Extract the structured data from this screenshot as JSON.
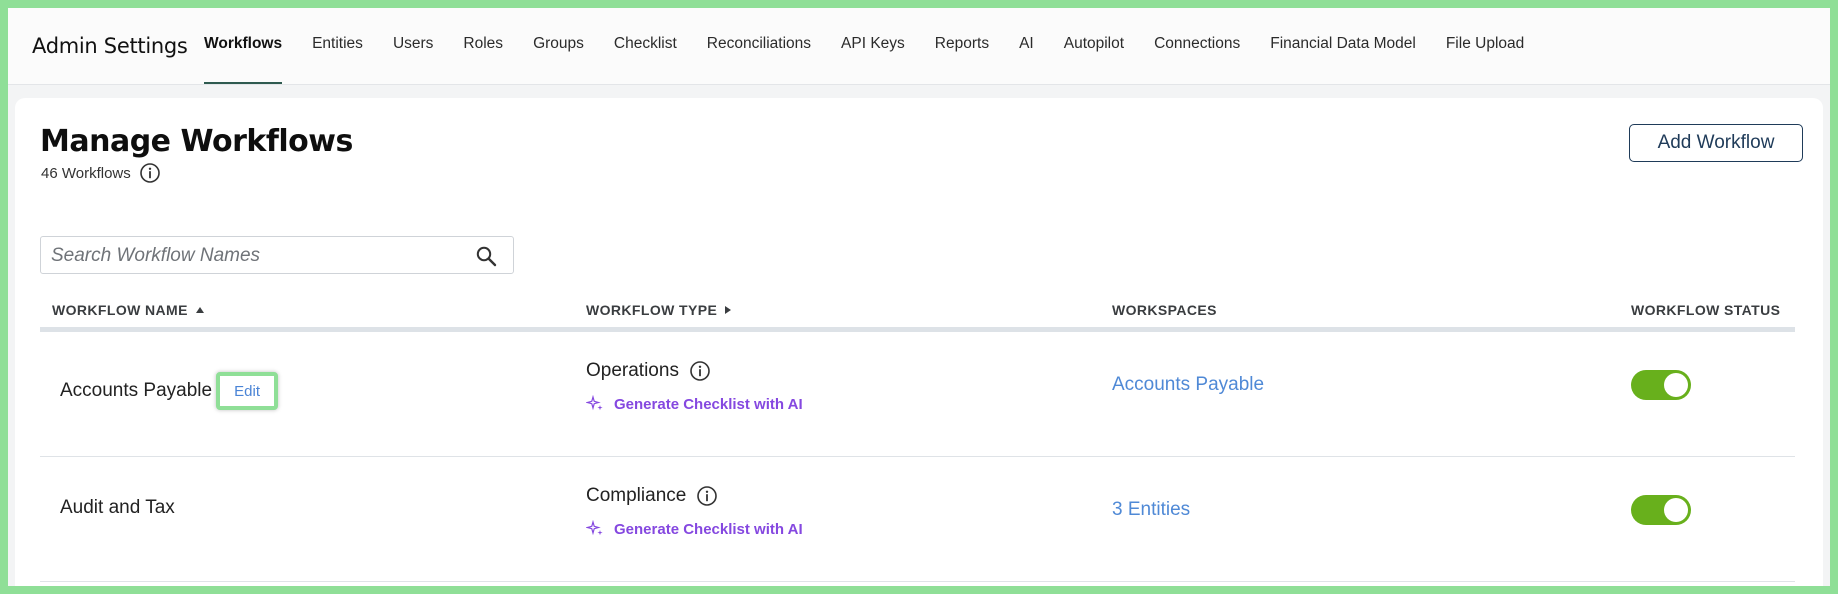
{
  "app": {
    "title": "Admin Settings"
  },
  "nav": {
    "tabs": [
      {
        "label": "Workflows",
        "active": true
      },
      {
        "label": "Entities"
      },
      {
        "label": "Users"
      },
      {
        "label": "Roles"
      },
      {
        "label": "Groups"
      },
      {
        "label": "Checklist"
      },
      {
        "label": "Reconciliations"
      },
      {
        "label": "API Keys"
      },
      {
        "label": "Reports"
      },
      {
        "label": "AI"
      },
      {
        "label": "Autopilot"
      },
      {
        "label": "Connections"
      },
      {
        "label": "Financial Data Model"
      },
      {
        "label": "File Upload"
      }
    ]
  },
  "page": {
    "title": "Manage Workflows",
    "count_text": "46 Workflows",
    "add_button": "Add Workflow"
  },
  "search": {
    "placeholder": "Search Workflow Names",
    "value": ""
  },
  "table": {
    "headers": {
      "name": "WORKFLOW NAME",
      "type": "WORKFLOW TYPE",
      "workspaces": "WORKSPACES",
      "status": "WORKFLOW STATUS"
    },
    "rows": [
      {
        "name": "Accounts Payable",
        "edit_label": "Edit",
        "type": "Operations",
        "generate_label": "Generate Checklist with AI",
        "workspaces": "Accounts Payable",
        "status_on": true
      },
      {
        "name": "Audit and Tax",
        "type": "Compliance",
        "generate_label": "Generate Checklist with AI",
        "workspaces": "3 Entities",
        "status_on": true
      }
    ]
  },
  "colors": {
    "accent_green": "#68b01c",
    "link_blue": "#4f89d6",
    "ai_purple": "#8548e0",
    "primary_navy": "#1f3b59",
    "highlight_frame": "#8fdf97"
  },
  "icons": [
    "info-icon",
    "search-icon",
    "sort-up-icon",
    "sort-right-icon",
    "sparkle-icon"
  ]
}
